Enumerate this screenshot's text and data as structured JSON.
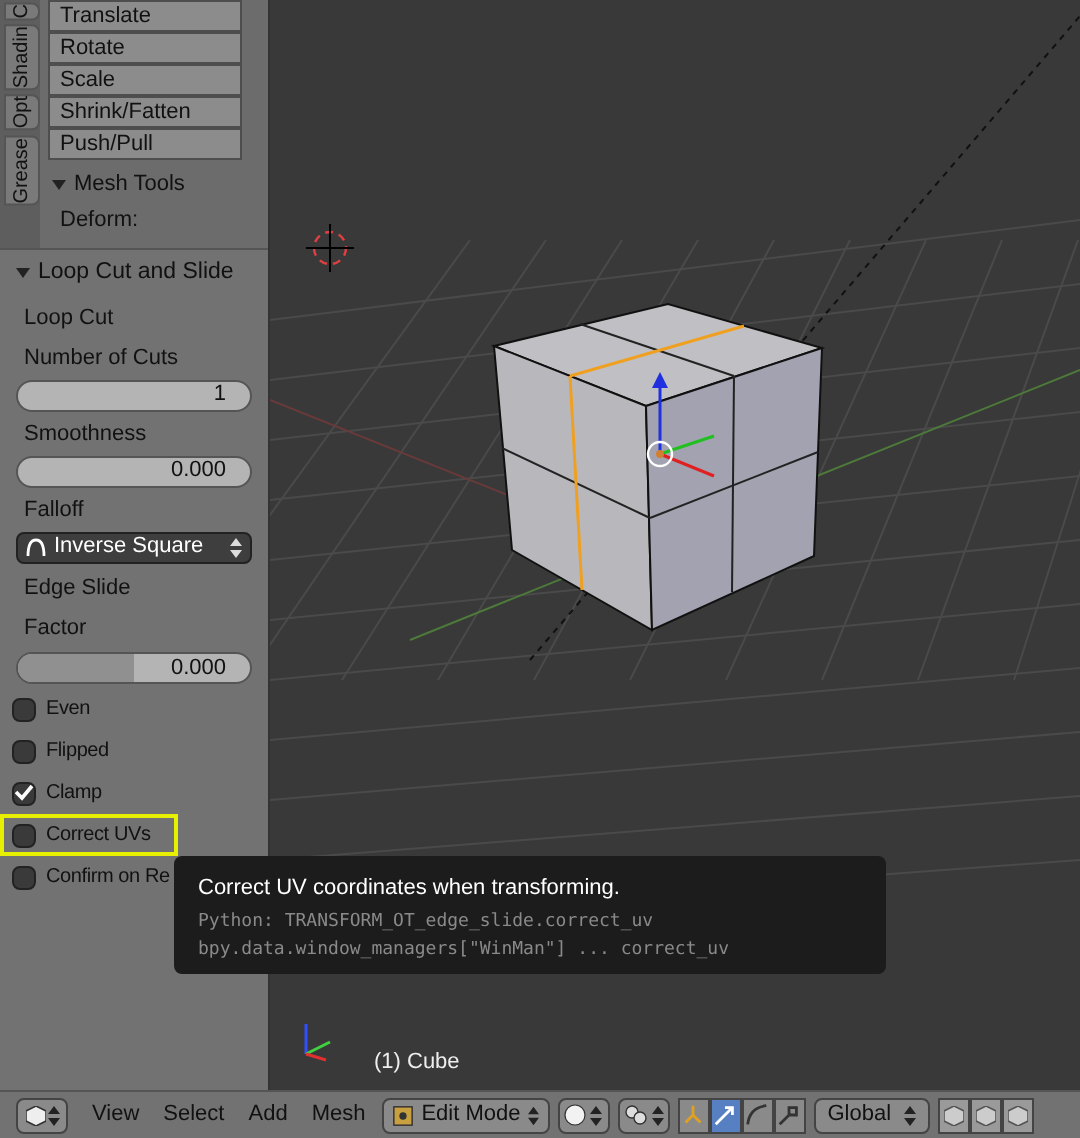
{
  "sidebar": {
    "tabs": [
      {
        "label": "C"
      },
      {
        "label": "Shadin"
      },
      {
        "label": "Opt"
      },
      {
        "label": "Grease"
      }
    ],
    "tool_buttons": [
      "Translate",
      "Rotate",
      "Scale",
      "Shrink/Fatten",
      "Push/Pull"
    ],
    "mesh_tools": {
      "title": "Mesh Tools",
      "expanded": true,
      "subheading": "Deform:"
    }
  },
  "operator_panel": {
    "title": "Loop Cut and Slide",
    "expanded": true,
    "items": [
      {
        "kind": "heading",
        "text": "Loop Cut"
      },
      {
        "kind": "label",
        "text": "Number of Cuts"
      },
      {
        "kind": "number",
        "value": "1"
      },
      {
        "kind": "label",
        "text": "Smoothness"
      },
      {
        "kind": "number",
        "value": "0.000"
      },
      {
        "kind": "label",
        "text": "Falloff"
      },
      {
        "kind": "dropdown",
        "value": "Inverse Square"
      },
      {
        "kind": "heading",
        "text": "Edge Slide"
      },
      {
        "kind": "label",
        "text": "Factor"
      },
      {
        "kind": "slider",
        "value": "0.000",
        "level": 0.5
      },
      {
        "kind": "checkbox",
        "text": "Even",
        "checked": false,
        "highlighted": false
      },
      {
        "kind": "checkbox",
        "text": "Flipped",
        "checked": false,
        "highlighted": false
      },
      {
        "kind": "checkbox",
        "text": "Clamp",
        "checked": true,
        "highlighted": false
      },
      {
        "kind": "checkbox",
        "text": "Correct UVs",
        "checked": false,
        "highlighted": true
      },
      {
        "kind": "checkbox",
        "text": "Confirm on Re",
        "checked": false,
        "highlighted": false
      }
    ]
  },
  "tooltip": {
    "title": "Correct UV coordinates when transforming.",
    "python": "Python: TRANSFORM_OT_edge_slide.correct_uv",
    "path": "bpy.data.window_managers[\"WinMan\"] ... correct_uv"
  },
  "viewport": {
    "object_label": "(1) Cube"
  },
  "header": {
    "menus": [
      "View",
      "Select",
      "Add",
      "Mesh"
    ],
    "mode": "Edit Mode",
    "orientation": "Global",
    "manipulators": [
      {
        "selected": false
      },
      {
        "selected": true
      },
      {
        "selected": false
      },
      {
        "selected": false
      }
    ]
  }
}
